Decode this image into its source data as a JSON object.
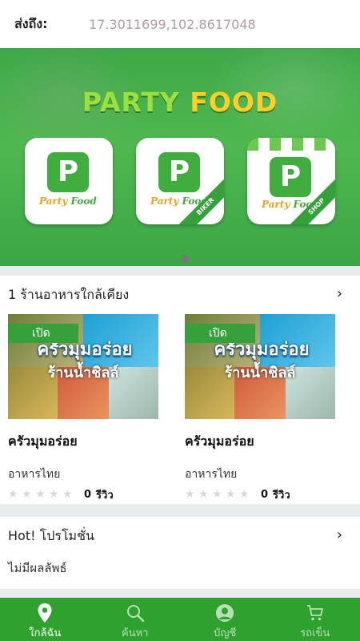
{
  "header": {
    "deliver_label": "ส่งถึง:",
    "coordinates": "17.3011699,102.8617048"
  },
  "banner": {
    "brand_word1": "PARTY",
    "brand_word2": "FOOD",
    "apps": [
      {
        "letter": "P",
        "name_a": "Party",
        "name_b": "Food",
        "ribbon": ""
      },
      {
        "letter": "P",
        "name_a": "Party",
        "name_b": "Food",
        "ribbon": "BIKER"
      },
      {
        "letter": "P",
        "name_a": "Party",
        "name_b": "Food",
        "ribbon": "SHOP"
      }
    ],
    "pager_count": 1
  },
  "nearby": {
    "title": "1 ร้านอาหารใกล้เคียง",
    "arrow": "›",
    "cards": [
      {
        "badge": "เปิด",
        "image_text": "ครัวมุมอร่อย",
        "image_sub": "ร้านน้ำชิลล์",
        "name": "ครัวมุมอร่อย",
        "category": "อาหารไทย",
        "rating": 0,
        "review_count": "0",
        "review_label": "รีวิว"
      },
      {
        "badge": "เปิด",
        "image_text": "ครัวมุมอร่อย",
        "image_sub": "ร้านน้ำชิลล์",
        "name": "ครัวมุมอร่อย",
        "category": "อาหารไทย",
        "rating": 0,
        "review_count": "0",
        "review_label": "รีวิว"
      }
    ]
  },
  "promo": {
    "title": "Hot! โปรโมชั่น",
    "arrow": "›",
    "empty_text": "ไม่มีผลลัพธ์"
  },
  "tabbar": {
    "active_color": "#ffffff",
    "bg_color": "#2fa12f",
    "tabs": [
      {
        "label": "ใกล้ฉัน",
        "icon": "location-pin-icon",
        "active": true
      },
      {
        "label": "ค้นหา",
        "icon": "search-icon",
        "active": false
      },
      {
        "label": "บัญชี",
        "icon": "user-icon",
        "active": false
      },
      {
        "label": "รถเข็น",
        "icon": "cart-icon",
        "active": false
      }
    ]
  }
}
